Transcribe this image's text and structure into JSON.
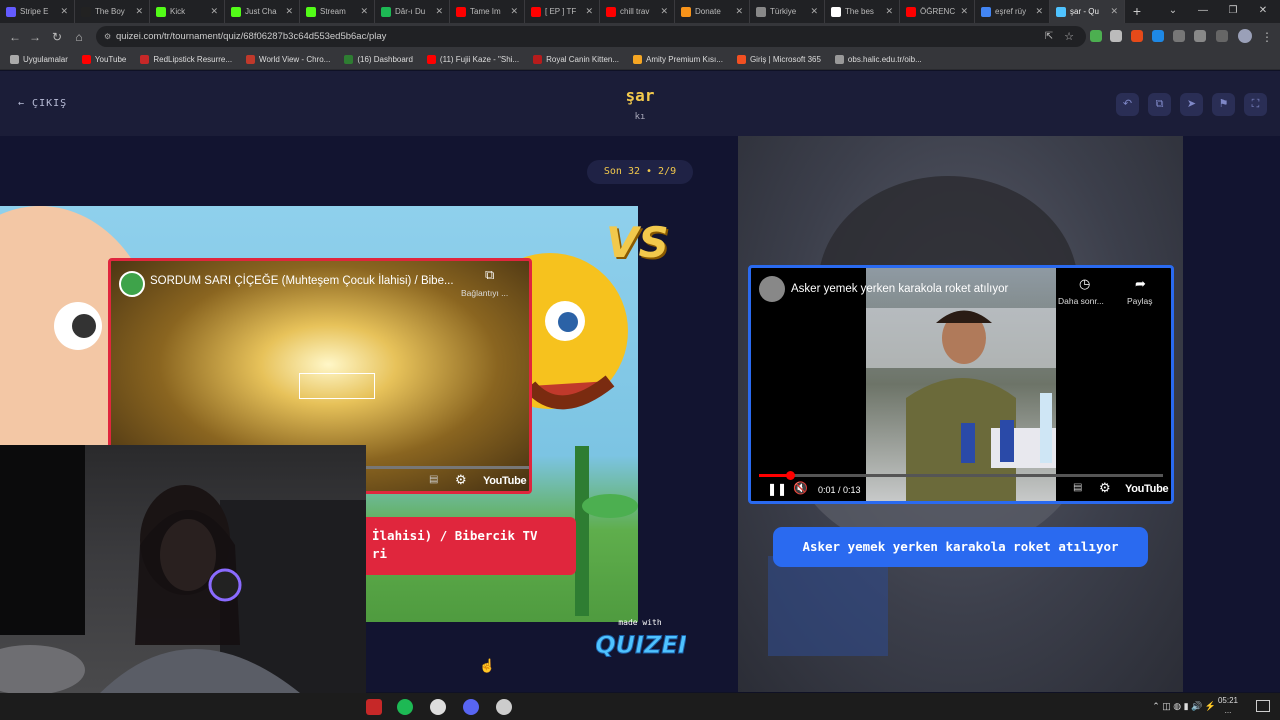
{
  "browser": {
    "tabs": [
      {
        "label": "Stripe E",
        "color": "#635bff"
      },
      {
        "label": "The Boy",
        "color": "#222"
      },
      {
        "label": "Kick",
        "color": "#53fc18"
      },
      {
        "label": "Just Cha",
        "color": "#53fc18"
      },
      {
        "label": "Stream",
        "color": "#53fc18"
      },
      {
        "label": "Dâr-ı Du",
        "color": "#1db954"
      },
      {
        "label": "Tame Im",
        "color": "#ff0000"
      },
      {
        "label": "[ EP ] TF",
        "color": "#ff0000"
      },
      {
        "label": "chill trav",
        "color": "#ff0000"
      },
      {
        "label": "Donate",
        "color": "#f7931a"
      },
      {
        "label": "Türkiye",
        "color": "#888"
      },
      {
        "label": "The bes",
        "color": "#fff"
      },
      {
        "label": "ÖĞRENC",
        "color": "#ff0000"
      },
      {
        "label": "eşref rüy",
        "color": "#4285f4"
      },
      {
        "label": "şar - Qu",
        "color": "#4fc3ff",
        "active": true
      }
    ],
    "url": "quizei.com/tr/tournament/quiz/68f06287b3c64d553ed5b6ac/play",
    "bookmarks": [
      {
        "label": "Uygulamalar",
        "color": "#aaa"
      },
      {
        "label": "YouTube",
        "color": "#ff0000"
      },
      {
        "label": "RedLipstick Resurre...",
        "color": "#c62828"
      },
      {
        "label": "World View - Chro...",
        "color": "#c0392b"
      },
      {
        "label": "(16) Dashboard",
        "color": "#2e7d32"
      },
      {
        "label": "(11) Fujii Kaze - \"Shi...",
        "color": "#ff0000"
      },
      {
        "label": "Royal Canin Kitten...",
        "color": "#b71c1c"
      },
      {
        "label": "Amity Premium Kısı...",
        "color": "#f5a623"
      },
      {
        "label": "Giriş | Microsoft 365",
        "color": "#f25022"
      },
      {
        "label": "obs.halic.edu.tr/oib...",
        "color": "#999"
      }
    ]
  },
  "quiz": {
    "exit_label": "ÇIKIŞ",
    "title": "şar",
    "subtitle": "kı",
    "round_label": "Son 32 • 2/9",
    "vs_label": "VS",
    "made_with": "made with",
    "brand": "QUIZEI",
    "accent_color": "#f2c94c",
    "left": {
      "video_title": "SORDUM SARI ÇİÇEĞE (Muhteşem Çocuk İlahisi) / Bibe...",
      "copy_label": "Bağlantıyı ...",
      "caption_line1": "İlahisi) / Bibercik TV",
      "caption_line2": "ri",
      "color": "#e0263d"
    },
    "right": {
      "video_title": "Asker yemek yerken karakola roket atılıyor",
      "later_label": "Daha sonr...",
      "share_label": "Paylaş",
      "time": "0:01 / 0:13",
      "progress": 0.077,
      "caption": "Asker yemek yerken karakola roket atılıyor",
      "color": "#2a6af0"
    },
    "youtube_label": "YouTube"
  },
  "taskbar": {
    "clock_time": "05:21",
    "clock_date": "..."
  }
}
